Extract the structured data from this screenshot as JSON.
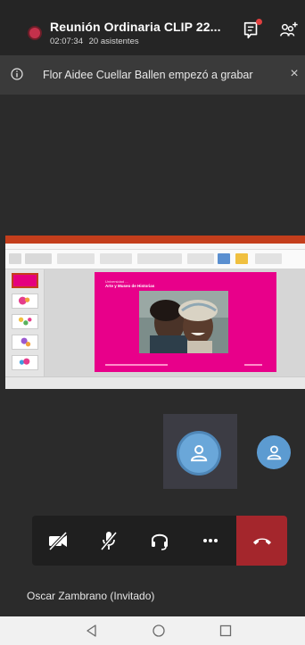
{
  "header": {
    "title": "Reunión Ordinaria CLIP 22...",
    "elapsed": "02:07:34",
    "attendees": "20 asistentes",
    "icons": [
      "recording-dot-icon",
      "chat-icon",
      "participants-add-icon"
    ]
  },
  "banner": {
    "message": "Flor Aidee Cuellar Ballen empezó a grabar",
    "close_label": "×",
    "icon": "info-icon"
  },
  "shared_screen": {
    "app": "PowerPoint",
    "slide": {
      "kicker": "Universidad ...",
      "title": "Arte y Museo de Historias"
    }
  },
  "participants": {
    "main_tile_icon": "person-icon",
    "small_tile_icon": "person-icon"
  },
  "controls": {
    "items": [
      "camera-off-icon",
      "mic-off-icon",
      "audio-headset-icon",
      "more-icon",
      "hang-up-icon"
    ]
  },
  "caption": {
    "name": "Oscar Zambrano (Invitado)"
  },
  "navbar": {
    "items": [
      "back-icon",
      "home-icon",
      "recents-icon"
    ]
  },
  "colors": {
    "recording": "#c4314b",
    "hangup": "#a4262c",
    "avatar": "#6aa7d9",
    "slide_bg": "#e8008a",
    "ppt_accent": "#c43e1c"
  }
}
